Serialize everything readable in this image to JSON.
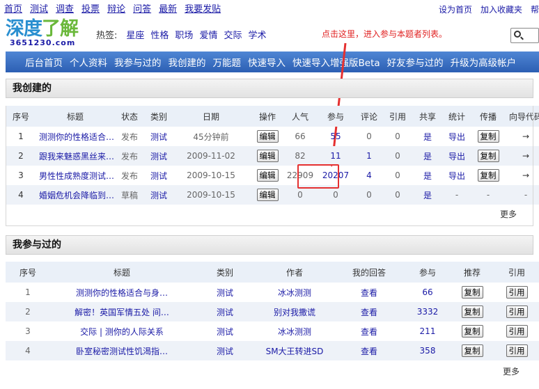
{
  "topnav": [
    "首页",
    "测试",
    "调查",
    "投票",
    "辩论",
    "问答",
    "最新",
    "我要发贴"
  ],
  "topright": [
    "设为首页",
    "加入收藏夹",
    "帮"
  ],
  "logo": {
    "main_a": "深度",
    "main_b": "了解",
    "sub": "3651230.com"
  },
  "hot": {
    "label": "热签:",
    "tags": [
      "星座",
      "性格",
      "职场",
      "爱情",
      "交际",
      "学术"
    ]
  },
  "callout": "点击这里，进入参与本题者列表。",
  "bluebar": [
    "后台首页",
    "个人资料",
    "我参与过的",
    "我创建的",
    "万能题",
    "快速导入",
    "快速导入增强版Beta",
    "好友参与过的",
    "升级为高级帐户"
  ],
  "created": {
    "title": "我创建的",
    "headers": [
      "序号",
      "标题",
      "状态",
      "类别",
      "日期",
      "操作",
      "人气",
      "参与",
      "评论",
      "引用",
      "共享",
      "统计",
      "传播",
      "向导代码"
    ],
    "rows": [
      [
        "1",
        "测测你的性格适合…",
        "发布",
        "测试",
        "45分钟前",
        "编辑",
        "66",
        "55",
        "0",
        "0",
        "是",
        "导出",
        "复制",
        "→"
      ],
      [
        "2",
        "跟我来魅惑黑丝来…",
        "发布",
        "测试",
        "2009-11-02",
        "编辑",
        "82",
        "11",
        "1",
        "0",
        "是",
        "导出",
        "复制",
        "→"
      ],
      [
        "3",
        "男性性成熟度测试…",
        "发布",
        "测试",
        "2009-10-15",
        "编辑",
        "22909",
        "20207",
        "4",
        "0",
        "是",
        "导出",
        "复制",
        "→"
      ],
      [
        "4",
        "婚姻危机会降临到…",
        "草稿",
        "测试",
        "2009-10-15",
        "编辑",
        "0",
        "0",
        "0",
        "0",
        "是",
        "-",
        "-",
        "-"
      ]
    ],
    "more": "更多"
  },
  "joined": {
    "title": "我参与过的",
    "headers": [
      "序号",
      "标题",
      "类别",
      "作者",
      "我的回答",
      "参与",
      "推荐",
      "引用"
    ],
    "rows": [
      [
        "1",
        "测测你的性格适合与身…",
        "测试",
        "冰冰测测",
        "查看",
        "66",
        "复制",
        "引用"
      ],
      [
        "2",
        "解密！英国军情五处 间…",
        "测试",
        "别对我撒谎",
        "查看",
        "3332",
        "复制",
        "引用"
      ],
      [
        "3",
        "交际 | 测你的人际关系",
        "测试",
        "冰冰测测",
        "查看",
        "211",
        "复制",
        "引用"
      ],
      [
        "4",
        "卧室秘密测试性饥渴指…",
        "测试",
        "SM大王转进SD",
        "查看",
        "358",
        "复制",
        "引用"
      ]
    ],
    "more": "更多"
  },
  "colors": {
    "accent_blue": "#2c5fb3",
    "link": "#1a1aa6",
    "highlight": "#e53030"
  }
}
